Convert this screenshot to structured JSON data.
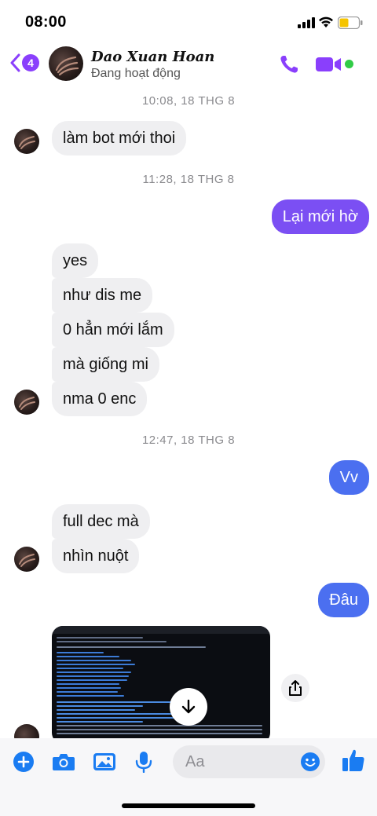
{
  "status_bar": {
    "time": "08:00"
  },
  "header": {
    "back_badge": "4",
    "contact_name": "Dao Xuan Hoan",
    "presence": "Đang hoạt động"
  },
  "colors": {
    "accent_purple": "#8a3ffc",
    "outgoing_purple": "#7b4ff3",
    "outgoing_blue": "#4b6ff0",
    "incoming_gray": "#efeff1",
    "online_green": "#31cc46",
    "composer_blue": "#1a7cf2"
  },
  "messages": {
    "ts1": "10:08, 18 THG 8",
    "m1": "làm bot mới thoi",
    "ts2": "11:28, 18 THG 8",
    "m2": "Lại mới hờ",
    "m3": "yes",
    "m4": "như dis me",
    "m5": "0 hẳn mới lắm",
    "m6": "mà giống mi",
    "m7": "nma 0 enc",
    "ts3": "12:47, 18 THG 8",
    "m8": "Vv",
    "m9": "full dec mà",
    "m10": "nhìn nuột",
    "m11": "Đâu"
  },
  "composer": {
    "placeholder": "Aa"
  },
  "icons": {
    "back": "chevron-left-icon",
    "call": "phone-icon",
    "video": "video-camera-icon",
    "plus": "plus-icon",
    "camera": "camera-icon",
    "gallery": "image-icon",
    "mic": "microphone-icon",
    "emoji": "emoji-icon",
    "like": "thumbs-up-icon",
    "download": "download-arrow-icon",
    "share": "share-icon"
  }
}
